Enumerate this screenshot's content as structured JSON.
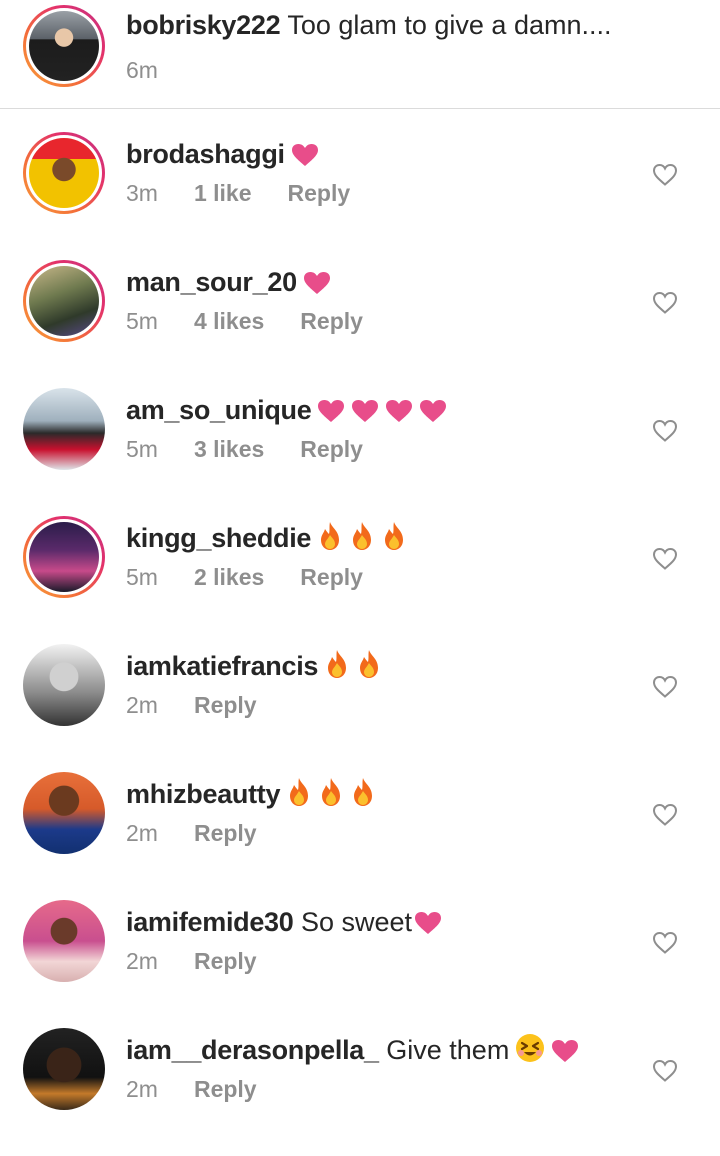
{
  "caption": {
    "username": "bobrisky222",
    "text": "Too glam to give a damn....",
    "time": "6m"
  },
  "comments": [
    {
      "username": "brodashaggi",
      "text": "",
      "emoji": [
        "heart"
      ],
      "time": "3m",
      "likes": "1 like",
      "reply": "Reply"
    },
    {
      "username": "man_sour_20",
      "text": "",
      "emoji": [
        "heart"
      ],
      "time": "5m",
      "likes": "4 likes",
      "reply": "Reply"
    },
    {
      "username": "am_so_unique",
      "text": "",
      "emoji": [
        "heart",
        "heart",
        "heart",
        "heart"
      ],
      "time": "5m",
      "likes": "3 likes",
      "reply": "Reply"
    },
    {
      "username": "kingg_sheddie",
      "text": "",
      "emoji": [
        "fire",
        "fire",
        "fire"
      ],
      "time": "5m",
      "likes": "2 likes",
      "reply": "Reply"
    },
    {
      "username": "iamkatiefrancis",
      "text": "",
      "emoji": [
        "fire",
        "fire"
      ],
      "time": "2m",
      "likes": "",
      "reply": "Reply"
    },
    {
      "username": "mhizbeautty",
      "text": "",
      "emoji": [
        "fire",
        "fire",
        "fire"
      ],
      "time": "2m",
      "likes": "",
      "reply": "Reply"
    },
    {
      "username": "iamifemide30",
      "text": "So sweet",
      "emoji": [
        "heart"
      ],
      "time": "2m",
      "likes": "",
      "reply": "Reply"
    },
    {
      "username": "iam__derasonpella_",
      "text": "Give them",
      "emoji": [
        "grinning-squinting-face",
        "heart"
      ],
      "time": "2m",
      "likes": "",
      "reply": "Reply"
    }
  ],
  "colors": {
    "heart": "#e84d8a",
    "fire": "#f26a1b",
    "meta_gray": "#8e8e8e",
    "divider": "#dbdbdb"
  }
}
